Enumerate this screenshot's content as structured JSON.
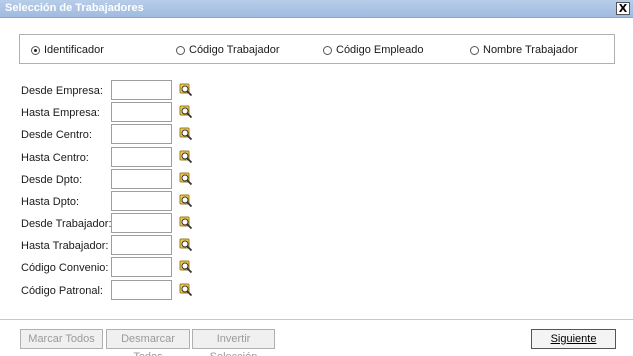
{
  "window": {
    "title": "Selección de Trabajadores",
    "close_glyph": "X"
  },
  "radio_options": [
    {
      "label": "Identificador",
      "checked": true
    },
    {
      "label": "Código Trabajador",
      "checked": false
    },
    {
      "label": "Código Empleado",
      "checked": false
    },
    {
      "label": "Nombre Trabajador",
      "checked": false
    }
  ],
  "fields": [
    {
      "label": "Desde Empresa:",
      "value": ""
    },
    {
      "label": "Hasta Empresa:",
      "value": ""
    },
    {
      "label": "Desde Centro:",
      "value": ""
    },
    {
      "label": "Hasta Centro:",
      "value": ""
    },
    {
      "label": "Desde Dpto:",
      "value": ""
    },
    {
      "label": "Hasta Dpto:",
      "value": ""
    },
    {
      "label": "Desde Trabajador:",
      "value": ""
    },
    {
      "label": "Hasta Trabajador:",
      "value": ""
    },
    {
      "label": "Código Convenio:",
      "value": ""
    },
    {
      "label": "Código Patronal:",
      "value": ""
    }
  ],
  "lookup_icon": "search-icon",
  "buttons": {
    "mark_all": "Marcar Todos",
    "unmark_all": "Desmarcar Todos",
    "invert": "Invertir Selección",
    "next": "Siguiente"
  },
  "colors": {
    "titlebar": "#a8c3e5",
    "icon_yellow": "#f2c94c"
  }
}
